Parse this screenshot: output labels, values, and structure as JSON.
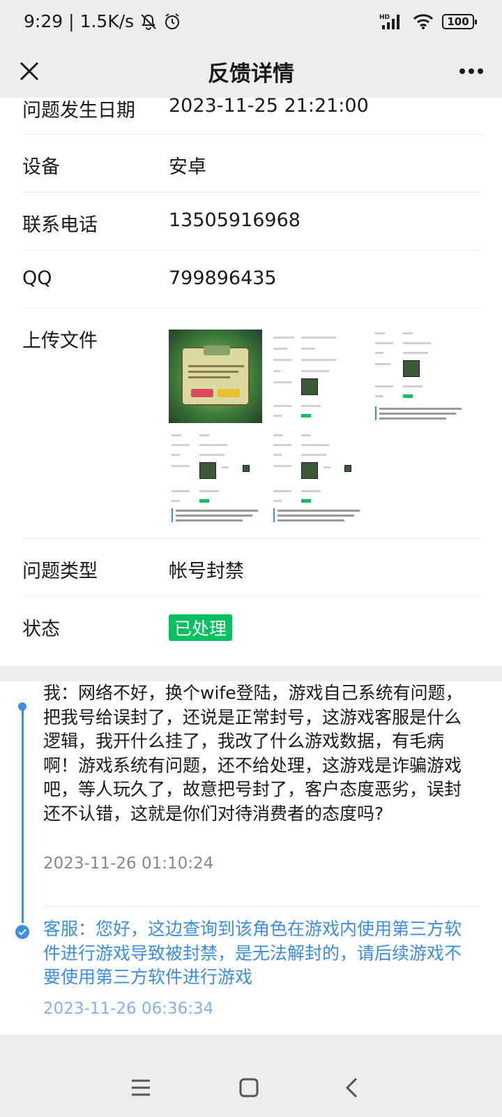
{
  "status_bar": {
    "time": "9:29",
    "speed": "1.5K/s",
    "battery": "100",
    "network": "HD"
  },
  "nav": {
    "title": "反馈详情"
  },
  "detail": {
    "date_label": "问题发生日期",
    "date_value": "2023-11-25 21:21:00",
    "device_label": "设备",
    "device_value": "安卓",
    "phone_label": "联系电话",
    "phone_value": "13505916968",
    "qq_label": "QQ",
    "qq_value": "799896435",
    "files_label": "上传文件",
    "type_label": "问题类型",
    "type_value": "帐号封禁",
    "status_label": "状态",
    "status_value": "已处理"
  },
  "timeline": {
    "user_msg": "我：网络不好，换个wife登陆，游戏自己系统有问题，把我号给误封了，还说是正常封号，这游戏客服是什么逻辑，我开什么挂了，我改了什么游戏数据，有毛病啊！游戏系统有问题，还不给处理，这游戏是诈骗游戏吧，等人玩久了，故意把号封了，客户态度恶劣，误封还不认错，这就是你们对待消费者的态度吗?",
    "user_time": "2023-11-26 01:10:24",
    "reply_msg": "客服：您好，这边查询到该角色在游戏内使用第三方软件进行游戏导致被封禁，是无法解封的，请后续游戏不要使用第三方软件进行游戏",
    "reply_time": "2023-11-26 06:36:34"
  },
  "colors": {
    "accent": "#3a8ee6",
    "success": "#07c160",
    "bg": "#ededed"
  }
}
